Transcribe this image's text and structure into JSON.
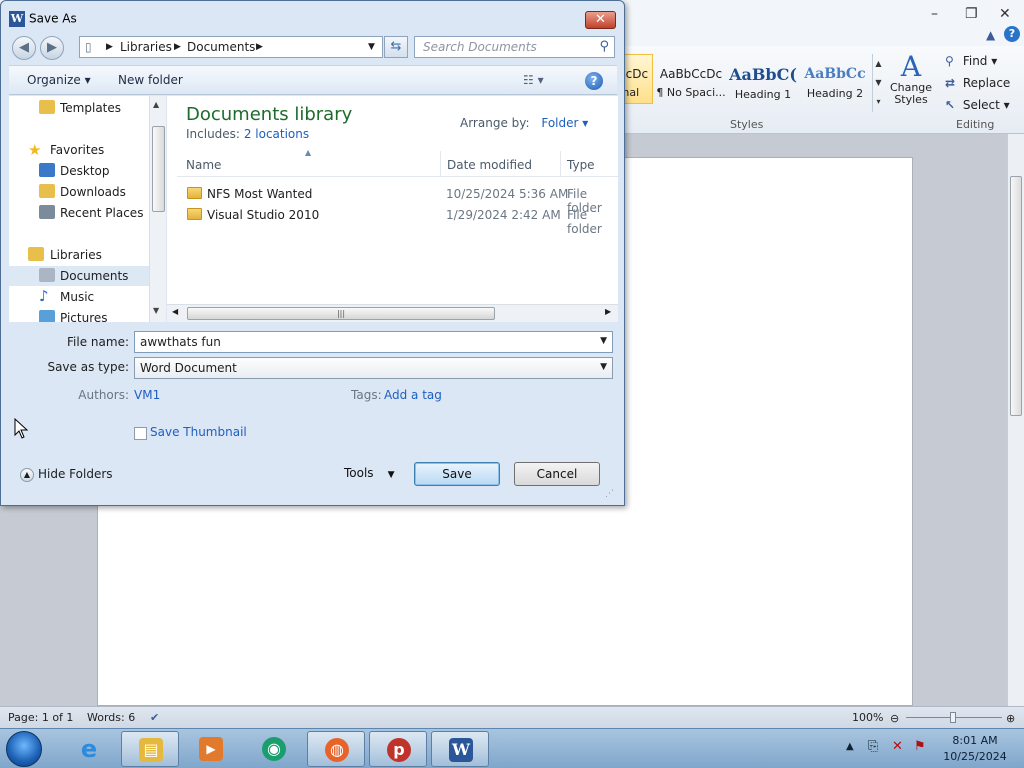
{
  "word": {
    "window_controls": [
      "–",
      "❐",
      "✕"
    ],
    "styles": [
      {
        "sample": "AaBbCcDc",
        "label": "¶ Normal"
      },
      {
        "sample": "AaBbCcDc",
        "label": "¶ No Spaci..."
      },
      {
        "sample": "AaBbC(",
        "label": "Heading 1"
      },
      {
        "sample": "AaBbCc",
        "label": "Heading 2"
      }
    ],
    "change_styles": "Change Styles",
    "styles_group_label": "Styles",
    "editing": {
      "find": "Find",
      "replace": "Replace",
      "select": "Select",
      "group_label": "Editing"
    },
    "status": {
      "page": "Page: 1 of 1",
      "words": "Words: 6",
      "zoom": "100%"
    }
  },
  "dialog": {
    "title": "Save As",
    "breadcrumb": [
      "Libraries",
      "Documents"
    ],
    "search_placeholder": "Search Documents",
    "commands": {
      "organize": "Organize",
      "new_folder": "New folder"
    },
    "nav": [
      {
        "label": "Templates",
        "icon": "folder-icon",
        "color": "#e8bf4b"
      },
      {
        "label": "Favorites",
        "icon": "star-icon",
        "color": "#f2b81e"
      },
      {
        "label": "Desktop",
        "icon": "desktop-icon",
        "color": "#3a78c8"
      },
      {
        "label": "Downloads",
        "icon": "downloads-icon",
        "color": "#e8bf4b"
      },
      {
        "label": "Recent Places",
        "icon": "recent-places-icon",
        "color": "#7b8b9b"
      },
      {
        "label": "Libraries",
        "icon": "libraries-icon",
        "color": "#e8bf4b"
      },
      {
        "label": "Documents",
        "icon": "documents-icon",
        "color": "#aab6c4"
      },
      {
        "label": "Music",
        "icon": "music-icon",
        "color": "#2d6cc0"
      },
      {
        "label": "Pictures",
        "icon": "pictures-icon",
        "color": "#5aa0d8"
      }
    ],
    "library": {
      "title": "Documents library",
      "includes_label": "Includes:",
      "includes_link": "2 locations",
      "arrange_label": "Arrange by:",
      "arrange_value": "Folder"
    },
    "columns": [
      "Name",
      "Date modified",
      "Type"
    ],
    "files": [
      {
        "name": "NFS Most Wanted",
        "date": "10/25/2024 5:36 AM",
        "type": "File folder"
      },
      {
        "name": "Visual Studio 2010",
        "date": "1/29/2024 2:42 AM",
        "type": "File folder"
      }
    ],
    "file_name_label": "File name:",
    "file_name_value": "awwthats fun",
    "save_type_label": "Save as type:",
    "save_type_value": "Word Document",
    "authors_label": "Authors:",
    "authors_value": "VM1",
    "tags_label": "Tags:",
    "tags_value": "Add a tag",
    "save_thumbnail": "Save Thumbnail",
    "save_thumbnail_checked": false,
    "hide_folders": "Hide Folders",
    "tools": "Tools",
    "save": "Save",
    "cancel": "Cancel"
  },
  "taskbar": {
    "time": "8:01 AM",
    "date": "10/25/2024",
    "apps": [
      {
        "name": "internet-explorer",
        "glyph": "e",
        "color": "#2a8be0"
      },
      {
        "name": "file-explorer",
        "glyph": "▤",
        "color": "#e5b93e"
      },
      {
        "name": "media-player",
        "glyph": "▶",
        "color": "#e27a2e"
      },
      {
        "name": "edge",
        "glyph": "◉",
        "color": "#1a9e6e"
      },
      {
        "name": "firefox",
        "glyph": "◍",
        "color": "#e8632a"
      },
      {
        "name": "p-app",
        "glyph": "p",
        "color": "#c0332b"
      },
      {
        "name": "word",
        "glyph": "W",
        "color": "#2b579a"
      }
    ]
  }
}
